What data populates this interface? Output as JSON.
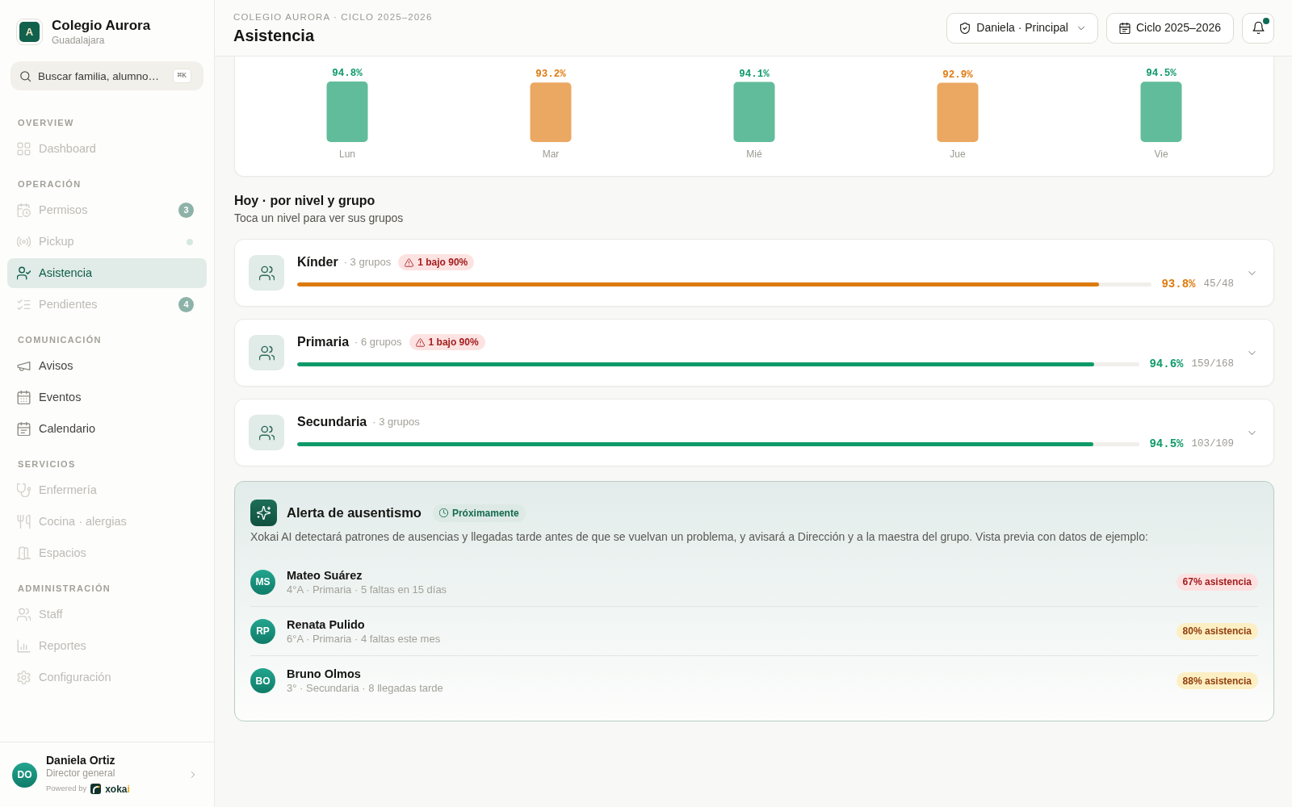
{
  "sidebar": {
    "brand": {
      "logo_letter": "A",
      "name": "Colegio Aurora",
      "location": "Guadalajara"
    },
    "search": {
      "placeholder": "Buscar familia, alumno…",
      "shortcut": "⌘K"
    },
    "sections": [
      {
        "title": "OVERVIEW",
        "items": [
          {
            "label": "Dashboard",
            "selected": false,
            "disabled": true,
            "dot": false
          }
        ]
      },
      {
        "title": "OPERACIÓN",
        "items": [
          {
            "label": "Permisos",
            "count": "3",
            "selected": false,
            "disabled": true,
            "dot": false
          },
          {
            "label": "Pickup",
            "selected": false,
            "disabled": true,
            "dot": true
          },
          {
            "label": "Asistencia",
            "selected": true,
            "disabled": false,
            "dot": false
          },
          {
            "label": "Pendientes",
            "count": "4",
            "selected": false,
            "disabled": true,
            "dot": false
          }
        ]
      },
      {
        "title": "COMUNICACIÓN",
        "items": [
          {
            "label": "Avisos",
            "selected": false,
            "disabled": false,
            "dot": false
          },
          {
            "label": "Eventos",
            "selected": false,
            "disabled": false,
            "dot": false
          },
          {
            "label": "Calendario",
            "selected": false,
            "disabled": false,
            "dot": false
          }
        ]
      },
      {
        "title": "SERVICIOS",
        "items": [
          {
            "label": "Enfermería",
            "selected": false,
            "disabled": true,
            "dot": false
          },
          {
            "label": "Cocina · alergias",
            "selected": false,
            "disabled": true,
            "dot": false
          },
          {
            "label": "Espacios",
            "selected": false,
            "disabled": true,
            "dot": false
          }
        ]
      },
      {
        "title": "ADMINISTRACIÓN",
        "items": [
          {
            "label": "Staff",
            "selected": false,
            "disabled": true,
            "dot": false
          },
          {
            "label": "Reportes",
            "selected": false,
            "disabled": true,
            "dot": false
          },
          {
            "label": "Configuración",
            "selected": false,
            "disabled": true,
            "dot": false
          }
        ]
      }
    ],
    "user": {
      "initials": "DO",
      "name": "Daniela Ortiz",
      "role": "Director general",
      "powered_by": "Powered by",
      "brand": "xokai"
    }
  },
  "header": {
    "breadcrumb": "COLEGIO AURORA · CICLO 2025–2026",
    "title": "Asistencia",
    "role_menu": "Daniela · Principal",
    "cycle": "Ciclo 2025–2026",
    "notifications_unread": true
  },
  "weekly_chart": {
    "chart_data": {
      "type": "bar",
      "categories": [
        "Lun",
        "Mar",
        "Mié",
        "Jue",
        "Vie"
      ],
      "series": [
        {
          "values": [
            94.8,
            93.2,
            94.1,
            92.9,
            94.5
          ],
          "value_labels": [
            "94.8%",
            "93.2%",
            "94.1%",
            "92.9%",
            "94.5%"
          ],
          "colors": [
            "#0f9a69",
            "#e07b10",
            "#0f9a69",
            "#e07b10",
            "#0f9a69"
          ]
        }
      ],
      "data_labels": true
    }
  },
  "levels_section": {
    "title": "Hoy · por nivel y grupo",
    "subtitle": "Toca un nivel para ver sus grupos",
    "levels": [
      {
        "name": "Kínder",
        "groups": "· 3 grupos",
        "alert": "1 bajo 90%",
        "level": 0.938,
        "percent": "93.8%",
        "count": "45/48",
        "color": "#dd7a0e",
        "expanded": false
      },
      {
        "name": "Primaria",
        "groups": "· 6 grupos",
        "alert": "1 bajo 90%",
        "level": 0.946,
        "percent": "94.6%",
        "count": "159/168",
        "color": "#0f9a69",
        "expanded": false
      },
      {
        "name": "Secundaria",
        "groups": "· 3 grupos",
        "level": 0.945,
        "percent": "94.5%",
        "count": "103/109",
        "color": "#0f9a69",
        "expanded": false
      }
    ]
  },
  "absence_alert": {
    "title": "Alerta de ausentismo",
    "badge": "Próximamente",
    "description": "Xokai AI detectará patrones de ausencias y llegadas tarde antes de que se vuelvan un problema, y avisará a Dirección y a la maestra del grupo. Vista previa con datos de ejemplo:",
    "students": [
      {
        "initials": "MS",
        "name": "Mateo Suárez",
        "detail": "4°A · Primaria · 5 faltas en 15 días",
        "attendance": "67% asistencia",
        "kind": "critical"
      },
      {
        "initials": "RP",
        "name": "Renata Pulido",
        "detail": "6°A · Primaria · 4 faltas este mes",
        "attendance": "80% asistencia",
        "kind": "warning"
      },
      {
        "initials": "BO",
        "name": "Bruno Olmos",
        "detail": "3° · Secundaria · 8 llegadas tarde",
        "attendance": "88% asistencia",
        "kind": "warning"
      }
    ]
  }
}
